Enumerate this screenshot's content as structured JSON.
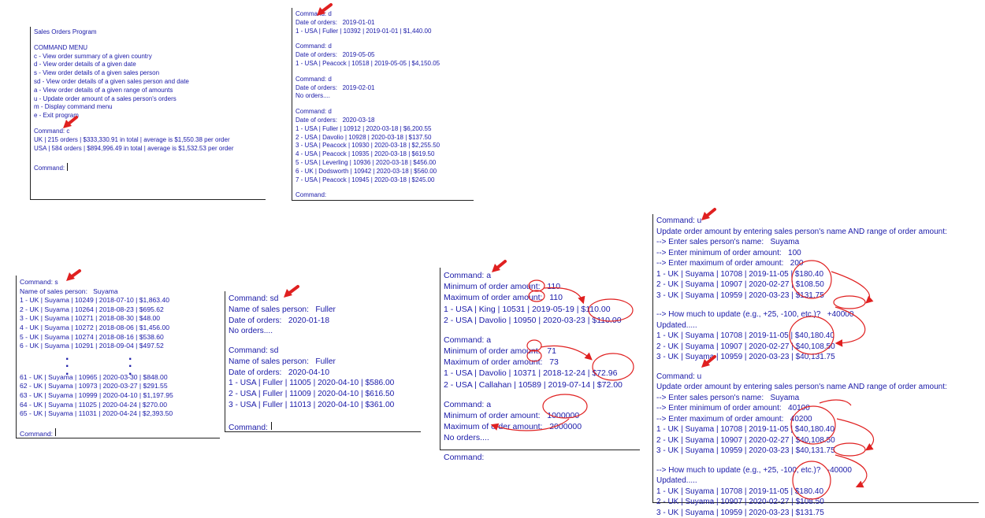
{
  "panel1": {
    "title": "Sales Orders Program",
    "menu_title": "COMMAND MENU",
    "menu_items": [
      "c - View order summary of a given country",
      "d - View order details of a given date",
      "s - View order details of a given sales person",
      "sd - View order details of a given sales person and date",
      "a - View order details of a given range of amounts",
      "u - Update order amount of a sales person's orders",
      "m - Display command menu",
      "e - Exit program"
    ],
    "command": "Command: c",
    "results": [
      "UK | 215 orders | $333,330.91 in total | average is $1,550.38 per order",
      "USA | 584 orders | $894,996.49 in total | average is $1,532.53 per order"
    ],
    "prompt": "Command: "
  },
  "panel2": {
    "blocks": [
      {
        "command": "Command: d",
        "date": "Date of orders:   2019-01-01",
        "rows": [
          "1 - USA | Fuller | 10392 | 2019-01-01 | $1,440.00"
        ]
      },
      {
        "command": "Command: d",
        "date": "Date of orders:   2019-05-05",
        "rows": [
          "1 - USA | Peacock | 10518 | 2019-05-05 | $4,150.05"
        ]
      },
      {
        "command": "Command: d",
        "date": "Date of orders:   2019-02-01",
        "rows": [
          "No orders...."
        ]
      },
      {
        "command": "Command: d",
        "date": "Date of orders:   2020-03-18",
        "rows": [
          "1 - USA | Fuller | 10912 | 2020-03-18 | $6,200.55",
          "2 - USA | Davolio | 10928 | 2020-03-18 | $137.50",
          "3 - USA | Peacock | 10930 | 2020-03-18 | $2,255.50",
          "4 - USA | Peacock | 10935 | 2020-03-18 | $619.50",
          "5 - USA | Leverling | 10936 | 2020-03-18 | $456.00",
          "6 - UK | Dodsworth | 10942 | 2020-03-18 | $560.00",
          "7 - USA | Peacock | 10945 | 2020-03-18 | $245.00"
        ]
      }
    ],
    "prompt": "Command:"
  },
  "panel3": {
    "command": "Command: s",
    "name": "Name of sales person:   Suyama",
    "rows_top": [
      "1 - UK | Suyama | 10249 | 2018-07-10 | $1,863.40",
      "2 - UK | Suyama | 10264 | 2018-08-23 | $695.62",
      "3 - UK | Suyama | 10271 | 2018-08-30 | $48.00",
      "4 - UK | Suyama | 10272 | 2018-08-06 | $1,456.00",
      "5 - UK | Suyama | 10274 | 2018-08-16 | $538.60",
      "6 - UK | Suyama | 10291 | 2018-09-04 | $497.52"
    ],
    "rows_bottom": [
      "61 - UK | Suyama | 10965 | 2020-03-30 | $848.00",
      "62 - UK | Suyama | 10973 | 2020-03-27 | $291.55",
      "63 - UK | Suyama | 10999 | 2020-04-10 | $1,197.95",
      "64 - UK | Suyama | 11025 | 2020-04-24 | $270.00",
      "65 - UK | Suyama | 11031 | 2020-04-24 | $2,393.50"
    ],
    "prompt": "Command: "
  },
  "panel4": {
    "blocks": [
      {
        "command": "Command: sd",
        "name": "Name of sales person:   Fuller",
        "date": "Date of orders:   2020-01-18",
        "rows": [
          "No orders...."
        ]
      },
      {
        "command": "Command: sd",
        "name": "Name of sales person:   Fuller",
        "date": "Date of orders:   2020-04-10",
        "rows": [
          "1 - USA | Fuller | 11005 | 2020-04-10 | $586.00",
          "2 - USA | Fuller | 11009 | 2020-04-10 | $616.50",
          "3 - USA | Fuller | 11013 | 2020-04-10 | $361.00"
        ]
      }
    ],
    "prompt": "Command: "
  },
  "panel5": {
    "blocks": [
      {
        "command": "Command: a",
        "min": "Minimum of order amount:   110",
        "max": "Maximum of order amount:   110",
        "rows": [
          "1 - USA | King | 10531 | 2019-05-19 | $110.00",
          "2 - USA | Davolio | 10950 | 2020-03-23 | $110.00"
        ]
      },
      {
        "command": "Command: a",
        "min": "Minimum of order amount:   71",
        "max": "Maximum of order amount:   73",
        "rows": [
          "1 - USA | Davolio | 10371 | 2018-12-24 | $72.96",
          "2 - USA | Callahan | 10589 | 2019-07-14 | $72.00"
        ]
      },
      {
        "command": "Command: a",
        "min": "Minimum of order amount:   1000000",
        "max": "Maximum of order amount:   2000000",
        "rows": [
          "No orders...."
        ]
      }
    ],
    "prompt": "Command:"
  },
  "panel6": {
    "blocks": [
      {
        "command": "Command: u",
        "intro": "Update order amount by entering sales person's name AND range of order amount:",
        "name": "--> Enter sales person's name:   Suyama",
        "min": "--> Enter minimum of order amount:   100",
        "max": "--> Enter maximum of order amount:   200",
        "rows_before": [
          "1 - UK | Suyama | 10708 | 2019-11-05 | $180.40",
          "2 - UK | Suyama | 10907 | 2020-02-27 | $108.50",
          "3 - UK | Suyama | 10959 | 2020-03-23 | $131.75"
        ],
        "question": "--> How much to update (e.g., +25, -100, etc.)?   +40000",
        "updated": "Updated.....",
        "rows_after": [
          "1 - UK | Suyama | 10708 | 2019-11-05 | $40,180.40",
          "2 - UK | Suyama | 10907 | 2020-02-27 | $40,108.50",
          "3 - UK | Suyama | 10959 | 2020-03-23 | $40,131.75"
        ]
      },
      {
        "command": "Command: u",
        "intro": "Update order amount by entering sales person's name AND range of order amount:",
        "name": "--> Enter sales person's name:   Suyama",
        "min": "--> Enter minimum of order amount:   40100",
        "max": "--> Enter maximum of order amount:   40200",
        "rows_before": [
          "1 - UK | Suyama | 10708 | 2019-11-05 | $40,180.40",
          "2 - UK | Suyama | 10907 | 2020-02-27 | $40,108.50",
          "3 - UK | Suyama | 10959 | 2020-03-23 | $40,131.75"
        ],
        "question": "--> How much to update (e.g., +25, -100, etc.)?   -40000",
        "updated": "Updated.....",
        "rows_after": [
          "1 - UK | Suyama | 10708 | 2019-11-05 | $180.40",
          "2 - UK | Suyama | 10907 | 2020-02-27 | $108.50",
          "3 - UK | Suyama | 10959 | 2020-03-23 | $131.75"
        ]
      }
    ]
  },
  "colors": {
    "console_text": "#1a1aa8",
    "annotation_red": "#e02020",
    "border": "#222222"
  }
}
